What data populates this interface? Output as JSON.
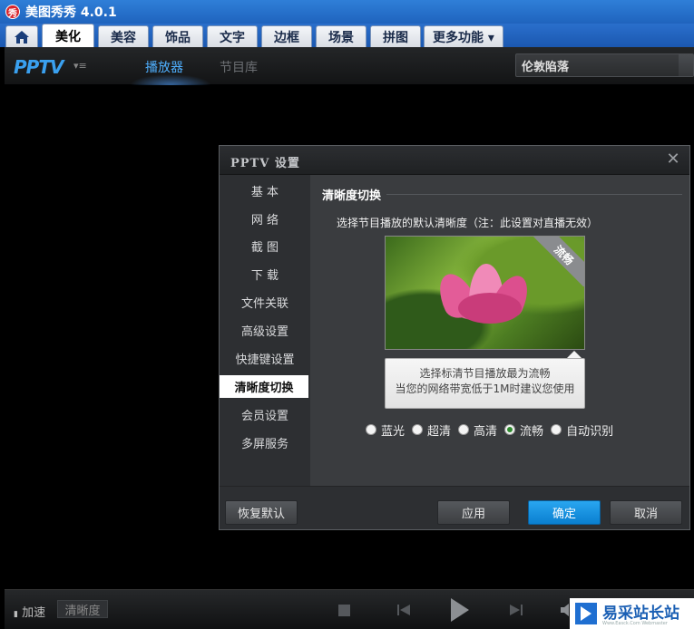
{
  "meitu": {
    "app_icon_text": "秀",
    "title": "美图秀秀 4.0.1",
    "tabs": [
      {
        "label": ""
      },
      {
        "label": "美化"
      },
      {
        "label": "美容"
      },
      {
        "label": "饰品"
      },
      {
        "label": "文字"
      },
      {
        "label": "边框"
      },
      {
        "label": "场景"
      },
      {
        "label": "拼图"
      },
      {
        "label": "更多功能 ▾"
      }
    ],
    "active_tab": "美化"
  },
  "pptv": {
    "logo": "PPTV",
    "logo_menu": "▾≡",
    "nav": [
      "播放器",
      "节目库"
    ],
    "active_nav": "播放器",
    "search_value": "伦敦陷落",
    "controls": {
      "accel_label": "加速",
      "quality_label": "清晰度"
    }
  },
  "dialog": {
    "title": "PPTV 设置",
    "close": "✕",
    "sidebar": [
      "基 本",
      "网 络",
      "截 图",
      "下 载",
      "文件关联",
      "高级设置",
      "快捷键设置",
      "清晰度切换",
      "会员设置",
      "多屏服务"
    ],
    "active_item": "清晰度切换",
    "section_title": "清晰度切换",
    "description": "选择节目播放的默认清晰度（注：此设置对直播无效）",
    "preview_badge": "流畅",
    "tooltip": {
      "line1": "选择标清节目播放最为流畅",
      "line2": "当您的网络带宽低于1M时建议您使用"
    },
    "quality_options": [
      "蓝光",
      "超清",
      "高清",
      "流畅",
      "自动识别"
    ],
    "selected_quality": "流畅",
    "buttons": {
      "restore": "恢复默认",
      "apply": "应用",
      "ok": "确定",
      "cancel": "取消"
    }
  },
  "watermark": {
    "text": "易采站长站",
    "sub": "Www.Easck.Com  Webmaster"
  },
  "colors": {
    "meitu_blue": "#1f63bd",
    "pptv_accent": "#4fb0ff",
    "primary_button": "#0a7fd0",
    "radio_checked": "#2f8a2f"
  }
}
